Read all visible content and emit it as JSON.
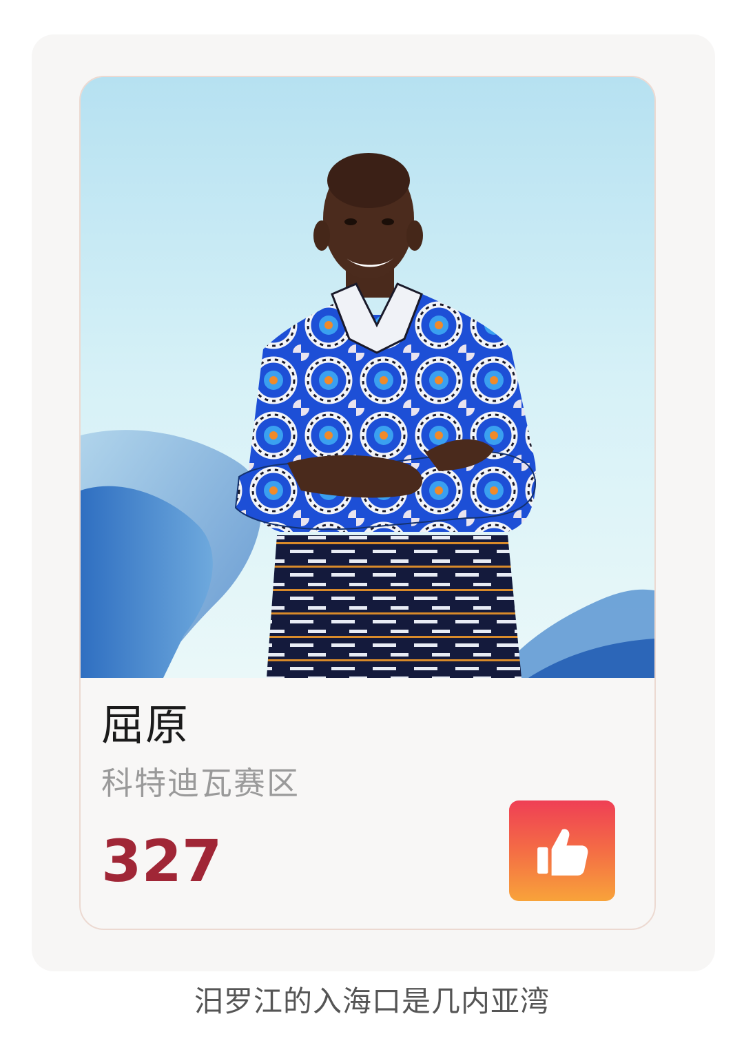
{
  "card": {
    "name": "屈原",
    "region": "科特迪瓦赛区",
    "votes": "327",
    "like_icon": "thumbs-up-icon",
    "like_gradient": [
      "#ef3f55",
      "#f8a33a"
    ],
    "vote_color": "#a02636"
  },
  "caption": "汨罗江的入海口是几内亚湾"
}
